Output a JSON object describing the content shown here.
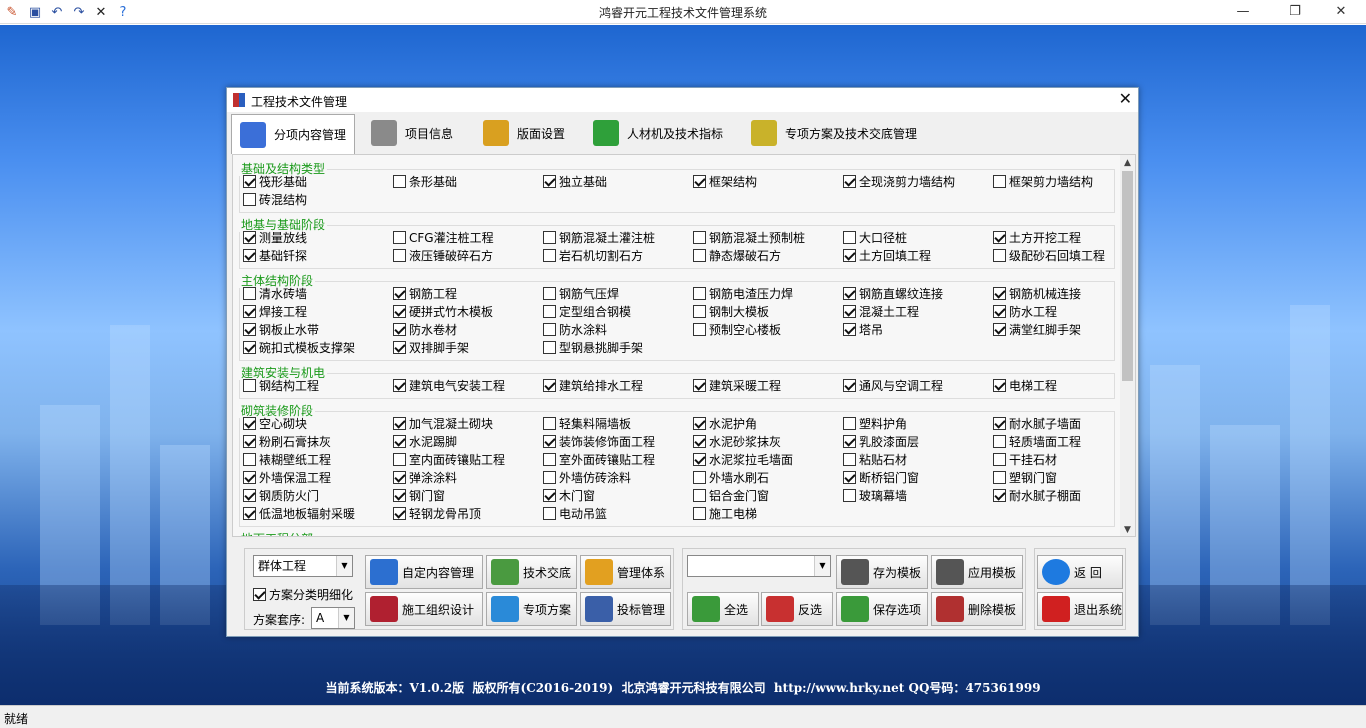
{
  "app": {
    "title": "鸿睿开元工程技术文件管理系统"
  },
  "status": {
    "text": "就绪"
  },
  "footer": {
    "text": "当前系统版本：V1.0.2版  版权所有(C2016-2019)  北京鸿睿开元科技有限公司  http://www.hrky.net QQ号码：475361999"
  },
  "dialog": {
    "title": "工程技术文件管理"
  },
  "tabs": [
    {
      "label": "分项内容管理",
      "active": true,
      "color": "#3b6fd8"
    },
    {
      "label": "项目信息",
      "color": "#8a8a8a"
    },
    {
      "label": "版面设置",
      "color": "#d9a020"
    },
    {
      "label": "人材机及技术指标",
      "color": "#2fa03a"
    },
    {
      "label": "专项方案及技术交底管理",
      "color": "#c9b22a"
    }
  ],
  "groups": [
    {
      "title": "基础及结构类型",
      "items": [
        {
          "label": "筏形基础",
          "checked": true
        },
        {
          "label": "条形基础",
          "checked": false
        },
        {
          "label": "独立基础",
          "checked": true
        },
        {
          "label": "框架结构",
          "checked": true
        },
        {
          "label": "全现浇剪力墙结构",
          "checked": true
        },
        {
          "label": "框架剪力墙结构",
          "checked": false
        },
        {
          "label": "砖混结构",
          "checked": false
        }
      ]
    },
    {
      "title": "地基与基础阶段",
      "items": [
        {
          "label": "测量放线",
          "checked": true
        },
        {
          "label": "CFG灌注桩工程",
          "checked": false
        },
        {
          "label": "钢筋混凝土灌注桩",
          "checked": false
        },
        {
          "label": "钢筋混凝土预制桩",
          "checked": false
        },
        {
          "label": "大口径桩",
          "checked": false
        },
        {
          "label": "土方开挖工程",
          "checked": true
        },
        {
          "label": "基础钎探",
          "checked": true
        },
        {
          "label": "液压锤破碎石方",
          "checked": false
        },
        {
          "label": "岩石机切割石方",
          "checked": false
        },
        {
          "label": "静态爆破石方",
          "checked": false
        },
        {
          "label": "土方回填工程",
          "checked": true
        },
        {
          "label": "级配砂石回填工程",
          "checked": false
        }
      ]
    },
    {
      "title": "主体结构阶段",
      "items": [
        {
          "label": "清水砖墙",
          "checked": false
        },
        {
          "label": "钢筋工程",
          "checked": true
        },
        {
          "label": "钢筋气压焊",
          "checked": false
        },
        {
          "label": "钢筋电渣压力焊",
          "checked": false
        },
        {
          "label": "钢筋直螺纹连接",
          "checked": true
        },
        {
          "label": "钢筋机械连接",
          "checked": true
        },
        {
          "label": "焊接工程",
          "checked": true
        },
        {
          "label": "硬拼式竹木模板",
          "checked": true
        },
        {
          "label": "定型组合钢模",
          "checked": false
        },
        {
          "label": "钢制大模板",
          "checked": false
        },
        {
          "label": "混凝土工程",
          "checked": true
        },
        {
          "label": "防水工程",
          "checked": true
        },
        {
          "label": "钢板止水带",
          "checked": true
        },
        {
          "label": "防水卷材",
          "checked": true
        },
        {
          "label": "防水涂料",
          "checked": false
        },
        {
          "label": "预制空心楼板",
          "checked": false
        },
        {
          "label": "塔吊",
          "checked": true
        },
        {
          "label": "满堂红脚手架",
          "checked": true
        },
        {
          "label": "碗扣式模板支撑架",
          "checked": true
        },
        {
          "label": "双排脚手架",
          "checked": true
        },
        {
          "label": "型钢悬挑脚手架",
          "checked": false
        }
      ]
    },
    {
      "title": "建筑安装与机电",
      "items": [
        {
          "label": "钢结构工程",
          "checked": false
        },
        {
          "label": "建筑电气安装工程",
          "checked": true
        },
        {
          "label": "建筑给排水工程",
          "checked": true
        },
        {
          "label": "建筑采暖工程",
          "checked": true
        },
        {
          "label": "通风与空调工程",
          "checked": true
        },
        {
          "label": "电梯工程",
          "checked": true
        }
      ]
    },
    {
      "title": "砌筑装修阶段",
      "items": [
        {
          "label": "空心砌块",
          "checked": true
        },
        {
          "label": "加气混凝土砌块",
          "checked": true
        },
        {
          "label": "轻集料隔墙板",
          "checked": false
        },
        {
          "label": "水泥护角",
          "checked": true
        },
        {
          "label": "塑料护角",
          "checked": false
        },
        {
          "label": "耐水腻子墙面",
          "checked": true
        },
        {
          "label": "粉刷石膏抹灰",
          "checked": true
        },
        {
          "label": "水泥踢脚",
          "checked": true
        },
        {
          "label": "装饰装修饰面工程",
          "checked": true
        },
        {
          "label": "水泥砂浆抹灰",
          "checked": true
        },
        {
          "label": "乳胶漆面层",
          "checked": true
        },
        {
          "label": "轻质墙面工程",
          "checked": false
        },
        {
          "label": "裱糊壁纸工程",
          "checked": false
        },
        {
          "label": "室内面砖镶贴工程",
          "checked": false
        },
        {
          "label": "室外面砖镶贴工程",
          "checked": false
        },
        {
          "label": "水泥浆拉毛墙面",
          "checked": true
        },
        {
          "label": "粘贴石材",
          "checked": false
        },
        {
          "label": "干挂石材",
          "checked": false
        },
        {
          "label": "外墙保温工程",
          "checked": true
        },
        {
          "label": "弹涂涂料",
          "checked": true
        },
        {
          "label": "外墙仿砖涂料",
          "checked": false
        },
        {
          "label": "外墙水刷石",
          "checked": false
        },
        {
          "label": "断桥铝门窗",
          "checked": true
        },
        {
          "label": "塑钢门窗",
          "checked": false
        },
        {
          "label": "钢质防火门",
          "checked": true
        },
        {
          "label": "钢门窗",
          "checked": true
        },
        {
          "label": "木门窗",
          "checked": true
        },
        {
          "label": "铝合金门窗",
          "checked": false
        },
        {
          "label": "玻璃幕墙",
          "checked": false
        },
        {
          "label": "耐水腻子棚面",
          "checked": true
        },
        {
          "label": "低温地板辐射采暖",
          "checked": true
        },
        {
          "label": "轻钢龙骨吊顶",
          "checked": true
        },
        {
          "label": "电动吊篮",
          "checked": false
        },
        {
          "label": "施工电梯",
          "checked": false
        }
      ]
    },
    {
      "title": "地下工程分部",
      "items": []
    }
  ],
  "bottom": {
    "type_value": "群体工程",
    "detail_label": "方案分类明细化",
    "detail_checked": true,
    "sequence_label": "方案套序:",
    "sequence_value": "A",
    "template_value": "",
    "buttons": {
      "custom": "自定内容管理",
      "tech": "技术交底",
      "mgmt": "管理体系",
      "org": "施工组织设计",
      "special": "专项方案",
      "bid": "投标管理",
      "save_tpl": "存为模板",
      "apply_tpl": "应用模板",
      "select_all": "全选",
      "invert": "反选",
      "save_opt": "保存选项",
      "del_tpl": "删除模板",
      "back": "返  回",
      "exit": "退出系统"
    }
  }
}
